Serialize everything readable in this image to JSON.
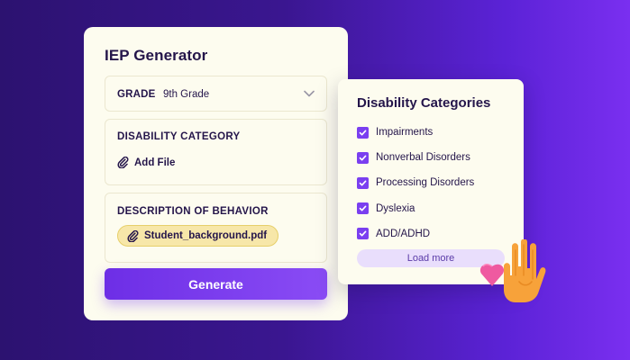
{
  "iep": {
    "title": "IEP Generator",
    "grade_label": "GRADE",
    "grade_value": "9th Grade",
    "disability_label": "DISABILITY CATEGORY",
    "add_file_label": "Add File",
    "description_label": "DESCRIPTION OF BEHAVIOR",
    "attached_file": "Student_background.pdf",
    "generate_label": "Generate"
  },
  "categories": {
    "title": "Disability Categories",
    "items": [
      {
        "label": "Impairments",
        "checked": true
      },
      {
        "label": "Nonverbal Disorders",
        "checked": true
      },
      {
        "label": "Processing Disorders",
        "checked": true
      },
      {
        "label": "Dyslexia",
        "checked": true
      },
      {
        "label": "ADD/ADHD",
        "checked": true
      }
    ],
    "load_more_label": "Load more"
  },
  "icons": {
    "chevron": "chevron-down-icon",
    "paperclip": "paperclip-icon",
    "checkbox": "checkbox-checked-icon",
    "hand_heart": "hand-heart-icon"
  },
  "colors": {
    "accent": "#7a3ff0",
    "card_bg": "#fdfcef",
    "text_dark": "#24154a",
    "chip_bg": "#f7e7a9"
  }
}
